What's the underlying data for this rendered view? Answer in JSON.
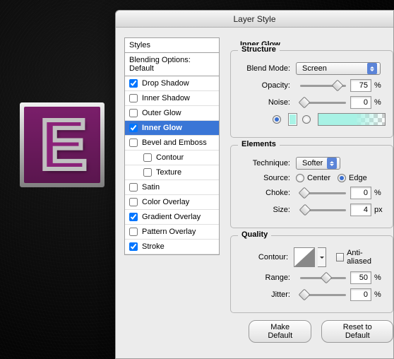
{
  "preview_letter": "E",
  "dialog": {
    "title": "Layer Style",
    "styles_header": "Styles",
    "blending_row": "Blending Options: Default",
    "styles": [
      {
        "label": "Drop Shadow",
        "checked": true,
        "indent": false
      },
      {
        "label": "Inner Shadow",
        "checked": false,
        "indent": false
      },
      {
        "label": "Outer Glow",
        "checked": false,
        "indent": false
      },
      {
        "label": "Inner Glow",
        "checked": true,
        "indent": false,
        "selected": true
      },
      {
        "label": "Bevel and Emboss",
        "checked": false,
        "indent": false
      },
      {
        "label": "Contour",
        "checked": false,
        "indent": true
      },
      {
        "label": "Texture",
        "checked": false,
        "indent": true
      },
      {
        "label": "Satin",
        "checked": false,
        "indent": false
      },
      {
        "label": "Color Overlay",
        "checked": false,
        "indent": false
      },
      {
        "label": "Gradient Overlay",
        "checked": true,
        "indent": false
      },
      {
        "label": "Pattern Overlay",
        "checked": false,
        "indent": false
      },
      {
        "label": "Stroke",
        "checked": true,
        "indent": false
      }
    ]
  },
  "panel": {
    "heading": "Inner Glow",
    "structure": {
      "legend": "Structure",
      "blend_mode_label": "Blend Mode:",
      "blend_mode_value": "Screen",
      "opacity_label": "Opacity:",
      "opacity_value": "75",
      "opacity_unit": "%",
      "noise_label": "Noise:",
      "noise_value": "0",
      "noise_unit": "%",
      "color_solid_selected": true,
      "color_swatch": "#a9f3e6"
    },
    "elements": {
      "legend": "Elements",
      "technique_label": "Technique:",
      "technique_value": "Softer",
      "source_label": "Source:",
      "source_center": "Center",
      "source_edge": "Edge",
      "source_selected": "edge",
      "choke_label": "Choke:",
      "choke_value": "0",
      "choke_unit": "%",
      "size_label": "Size:",
      "size_value": "4",
      "size_unit": "px"
    },
    "quality": {
      "legend": "Quality",
      "contour_label": "Contour:",
      "antialiased_label": "Anti-aliased",
      "antialiased_checked": false,
      "range_label": "Range:",
      "range_value": "50",
      "range_unit": "%",
      "jitter_label": "Jitter:",
      "jitter_value": "0",
      "jitter_unit": "%"
    },
    "buttons": {
      "make_default": "Make Default",
      "reset": "Reset to Default"
    }
  }
}
